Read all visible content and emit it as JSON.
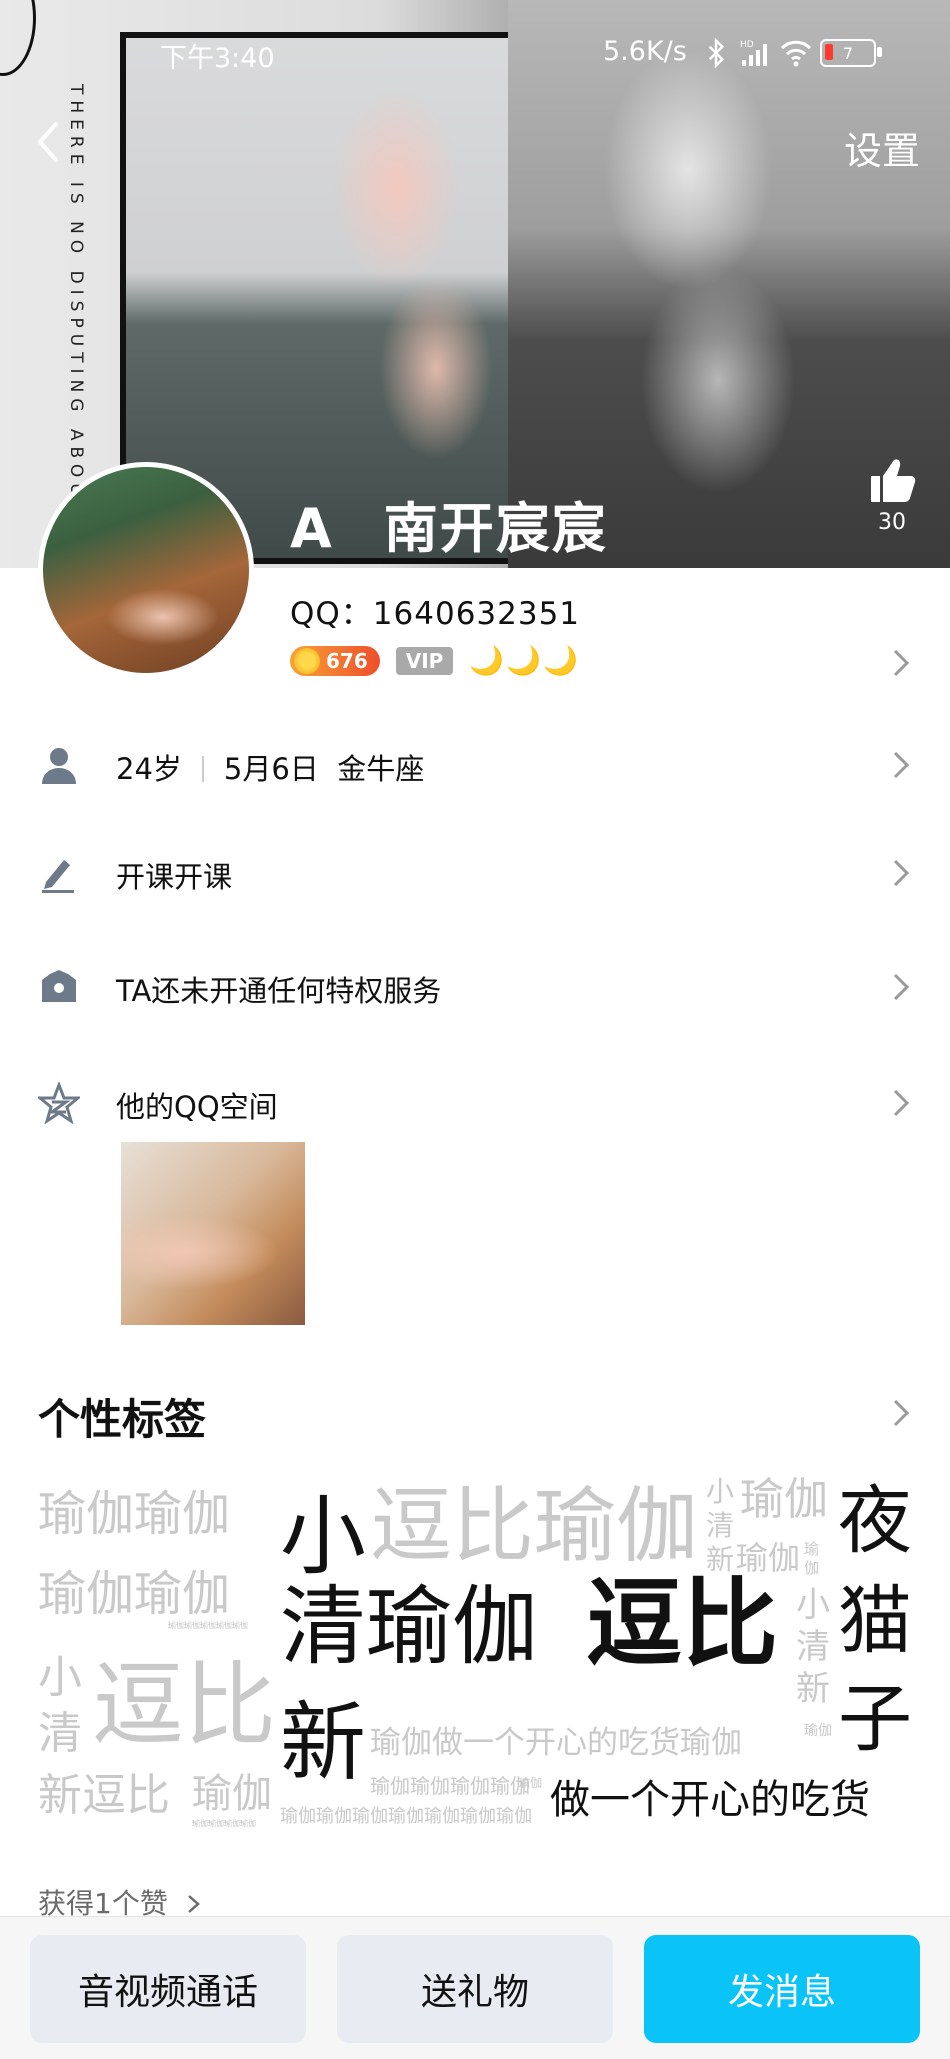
{
  "status_bar": {
    "time": "下午3:40",
    "net_speed": "5.6K/s",
    "signal_label": "HD",
    "battery": "7"
  },
  "cover": {
    "vertical_text": "THERE IS NO DISPUTING ABOUT T"
  },
  "header": {
    "settings_label": "设置",
    "like_count": "30"
  },
  "profile": {
    "nickname_prefix": "A",
    "nickname": "南开宸宸",
    "qq_label": "QQ：1640632351",
    "level": "676",
    "vip": "VIP",
    "moons": "🌙🌙🌙"
  },
  "info_rows": [
    {
      "age": "24岁",
      "birthday": "5月6日",
      "zodiac": "金牛座"
    },
    {
      "text": "开课开课"
    },
    {
      "text": "TA还未开通任何特权服务"
    },
    {
      "text": "他的QQ空间"
    }
  ],
  "tags_section": {
    "title": "个性标签",
    "cloud": {
      "t1": "瑜伽瑜伽",
      "t2": "瑜伽瑜伽",
      "t3": "瑜伽瑜伽瑜伽瑜伽瑜伽",
      "t4": "小",
      "t5": "清",
      "t6": "逗比",
      "t7": "新逗比",
      "t8": "瑜伽",
      "t9": "瑜伽瑜伽瑜伽瑜伽",
      "t10": "小",
      "t11": "逗比瑜伽",
      "t12": "小",
      "t13": "清",
      "t14": "新",
      "t15": "瑜伽",
      "t16": "瑜伽",
      "t17": "瑜伽",
      "t18": "夜",
      "t19": "猫",
      "t20": "子",
      "t21": "清瑜伽",
      "t22": "逗比",
      "t23": "小",
      "t24": "清",
      "t25": "新",
      "t26": "新",
      "t27": "瑜伽做一个开心的吃货瑜伽",
      "t28": "瑜伽",
      "t29": "瑜伽瑜伽瑜伽瑜伽",
      "t30": "瑜伽",
      "t31": "瑜伽瑜伽瑜伽瑜伽瑜伽瑜伽瑜伽",
      "t32": "做一个开心的吃货",
      "t33": "瑜伽",
      "t34": "瑜伽",
      "t35": "瑜伽",
      "t36": "小",
      "t37": "清",
      "t38": "新"
    }
  },
  "likes_link": "获得1个赞",
  "bottom_buttons": {
    "call": "音视频通话",
    "gift": "送礼物",
    "message": "发消息"
  },
  "colors": {
    "primary": "#0ac4f8",
    "secondary_btn": "#e8ebf1",
    "tag_gray": "#c9c9c9",
    "level_badge": "#ef4f2a",
    "moon": "#f2b400"
  }
}
